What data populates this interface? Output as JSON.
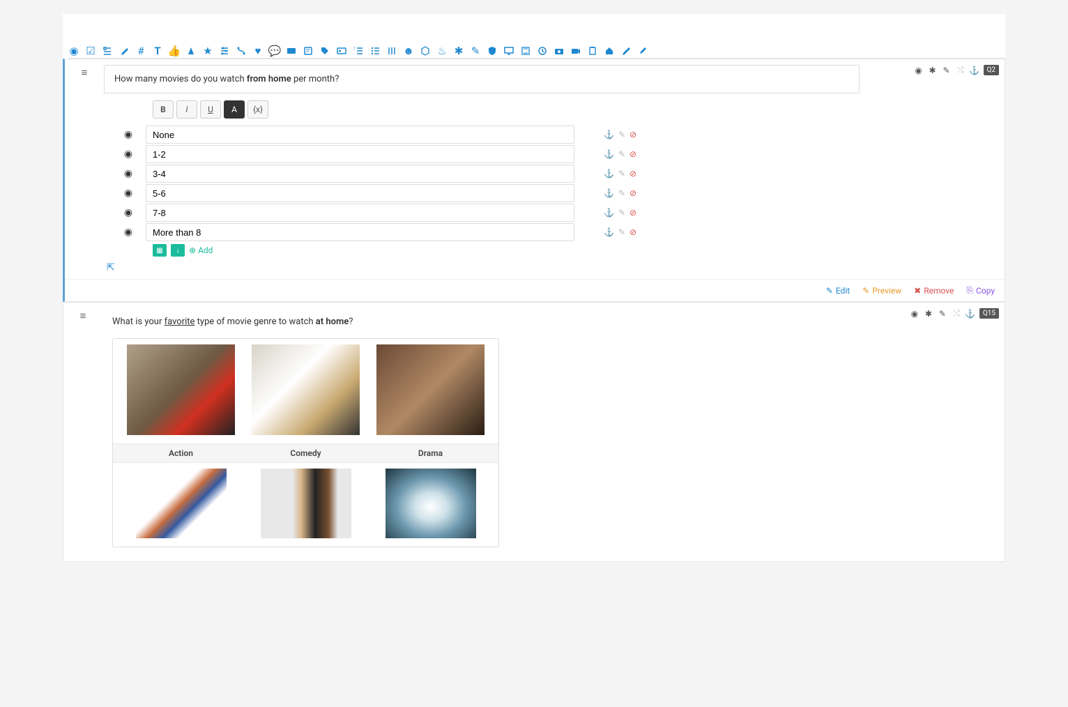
{
  "toolbar": {
    "icons": [
      "radio-icon",
      "checkbox-icon",
      "list-icon",
      "dropper-icon",
      "grid-icon",
      "text-icon",
      "thumbs-up-icon",
      "money-icon",
      "star-icon",
      "sliders-icon",
      "route-icon",
      "heart-icon",
      "comment-icon",
      "card-icon",
      "note-icon",
      "tag-icon",
      "id-icon",
      "list-ol-icon",
      "list-ul-icon",
      "columns-icon",
      "smile-icon",
      "cube-icon",
      "fire-icon",
      "asterisk-icon",
      "pencil-icon",
      "shield-icon",
      "desktop-icon",
      "hourglass-icon",
      "clock-icon",
      "camera-icon",
      "video-icon",
      "clipboard-icon",
      "home-icon",
      "paint-icon",
      "brush-icon"
    ]
  },
  "q2": {
    "drag_icon": "reorder-icon",
    "status_icons": [
      "radio-type-icon",
      "required-icon",
      "wand-icon",
      "shuffle-icon",
      "anchor-icon"
    ],
    "badge": "Q2",
    "question_parts": {
      "pre": "How many movies do you watch ",
      "bold": "from home",
      "post": " per month?"
    },
    "fmt": {
      "bold": "B",
      "italic": "I",
      "underline": "U",
      "bg": "A",
      "var": "{x}"
    },
    "options": [
      "None",
      "1-2",
      "3-4",
      "5-6",
      "7-8",
      "More than 8"
    ],
    "row_action_icons": [
      "anchor-icon",
      "edit-icon",
      "delete-icon"
    ],
    "add_label": "Add",
    "expand_icon": "expand-icon"
  },
  "card_actions": {
    "edit": "Edit",
    "preview": "Preview",
    "remove": "Remove",
    "copy": "Copy"
  },
  "q15": {
    "drag_icon": "reorder-icon",
    "status_icons": [
      "radio-type-icon",
      "required-icon",
      "wand-icon",
      "shuffle-icon",
      "anchor-icon"
    ],
    "badge": "Q15",
    "question_parts": {
      "pre": "What is your ",
      "underline": "favorite",
      "mid": " type of movie genre to watch ",
      "bold": "at home",
      "post": "?"
    },
    "labels": [
      "Action",
      "Comedy",
      "Drama"
    ]
  }
}
